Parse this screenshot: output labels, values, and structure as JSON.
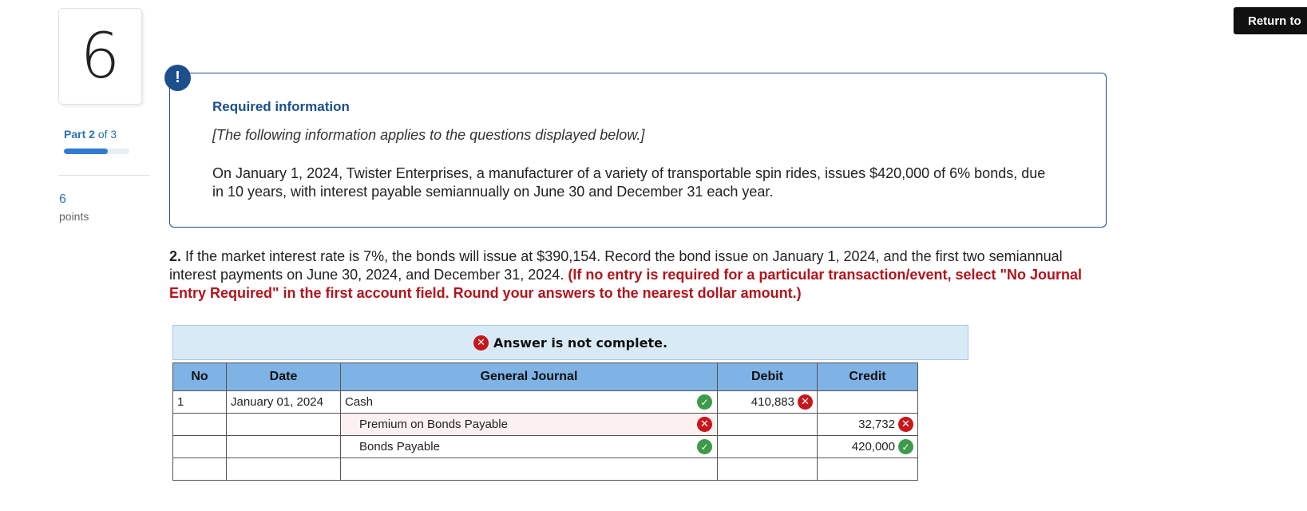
{
  "question_number": "6",
  "part": {
    "label": "Part 2",
    "of": "of 3",
    "progress_fraction": 0.667
  },
  "points": {
    "value": "6",
    "label": "points"
  },
  "return_button": "Return to",
  "info": {
    "icon": "!",
    "title": "Required information",
    "subtitle": "[The following information applies to the questions displayed below.]",
    "body": "On January 1, 2024, Twister Enterprises, a manufacturer of a variety of transportable spin rides, issues $420,000 of 6% bonds, due in 10 years, with interest payable semiannually on June 30 and December 31 each year."
  },
  "question": {
    "number": "2.",
    "text": "If the market interest rate is 7%, the bonds will issue at $390,154. Record the bond issue on January 1, 2024, and the first two semiannual interest payments on June 30, 2024, and December 31, 2024.",
    "instruction": "(If no entry is required for a particular transaction/event, select \"No Journal Entry Required\" in the first account field. Round your answers to the nearest dollar amount.)"
  },
  "answer_banner": "Answer is not complete.",
  "table": {
    "headers": [
      "No",
      "Date",
      "General Journal",
      "Debit",
      "Credit"
    ],
    "rows": [
      {
        "no": "1",
        "date": "January 01, 2024",
        "account": "Cash",
        "debit": "410,883",
        "credit": "",
        "account_status": "correct",
        "debit_status": "incorrect",
        "credit_status": ""
      },
      {
        "no": "",
        "date": "",
        "account": "Premium on Bonds Payable",
        "debit": "",
        "credit": "32,732",
        "account_status": "incorrect",
        "debit_status": "",
        "credit_status": "incorrect"
      },
      {
        "no": "",
        "date": "",
        "account": "Bonds Payable",
        "debit": "",
        "credit": "420,000",
        "account_status": "correct",
        "debit_status": "",
        "credit_status": "correct"
      },
      {
        "no": "",
        "date": "",
        "account": "",
        "debit": "",
        "credit": "",
        "account_status": "",
        "debit_status": "",
        "credit_status": ""
      }
    ]
  },
  "colors": {
    "accent": "#1c4f8c",
    "error": "#c8161d",
    "success": "#3d9a4a",
    "header": "#7fb2e5"
  }
}
